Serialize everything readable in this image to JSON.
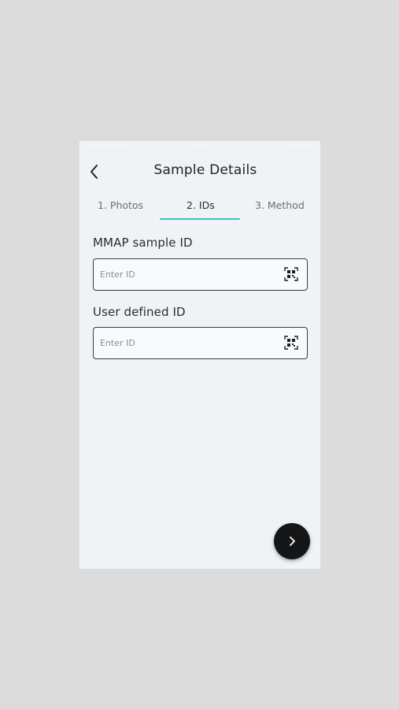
{
  "header": {
    "title": "Sample Details",
    "back_icon": "chevron-left-icon"
  },
  "tabs": [
    {
      "label": "1. Photos",
      "active": false
    },
    {
      "label": "2. IDs",
      "active": true
    },
    {
      "label": "3. Method",
      "active": false
    }
  ],
  "fields": [
    {
      "label": "MMAP sample ID",
      "placeholder": "Enter ID",
      "value": "",
      "icon": "qr-scan-icon"
    },
    {
      "label": "User defined ID",
      "placeholder": "Enter ID",
      "value": "",
      "icon": "qr-scan-icon"
    }
  ],
  "fab": {
    "icon": "chevron-right-icon"
  },
  "colors": {
    "accent": "#3dc1b8",
    "background": "#eff3f5",
    "fab": "#141618"
  }
}
